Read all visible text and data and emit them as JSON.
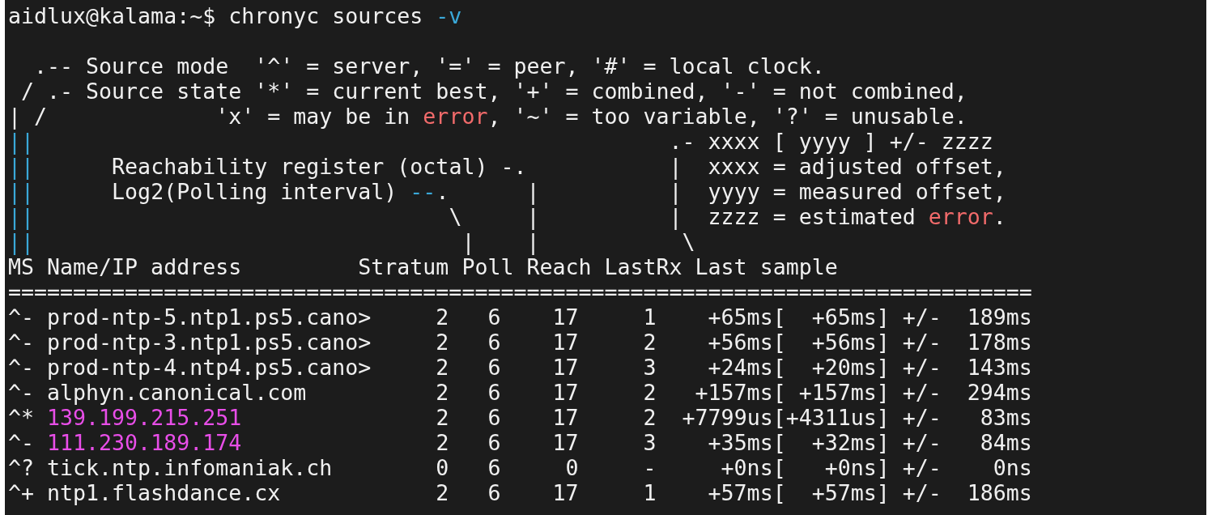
{
  "terminal": {
    "lines": [
      {
        "kind": "prompt",
        "segments": [
          {
            "kind": "plain",
            "text": "aidlux@kalama:~$ chronyc sources "
          },
          {
            "kind": "option",
            "text": "-v"
          }
        ]
      },
      {
        "kind": "blank"
      },
      {
        "kind": "output",
        "segments": [
          {
            "kind": "plain",
            "text": "  .-- Source mode  '^' = server, '=' = peer, '#' = local clock."
          }
        ]
      },
      {
        "kind": "output",
        "segments": [
          {
            "kind": "plain",
            "text": " / .- Source state '*' = current best, '+' = combined, '-' = not combined,"
          }
        ]
      },
      {
        "kind": "output",
        "segments": [
          {
            "kind": "plain",
            "text": "| /             'x' = may be in "
          },
          {
            "kind": "error",
            "text": "error"
          },
          {
            "kind": "plain",
            "text": ", '~' = too variable, '?' = unusable."
          }
        ]
      },
      {
        "kind": "output",
        "segments": [
          {
            "kind": "tree",
            "text": "||"
          },
          {
            "kind": "plain",
            "text": "                                                 .- xxxx [ yyyy ] +/- zzzz"
          }
        ]
      },
      {
        "kind": "output",
        "segments": [
          {
            "kind": "tree",
            "text": "||"
          },
          {
            "kind": "plain",
            "text": "      Reachability register (octal) -.           |  xxxx = adjusted offset,"
          }
        ]
      },
      {
        "kind": "output",
        "segments": [
          {
            "kind": "tree",
            "text": "||"
          },
          {
            "kind": "plain",
            "text": "      Log2(Polling interval) "
          },
          {
            "kind": "option",
            "text": "--"
          },
          {
            "kind": "plain",
            "text": ".      |          |  yyyy = measured offset,"
          }
        ]
      },
      {
        "kind": "output",
        "segments": [
          {
            "kind": "tree",
            "text": "||"
          },
          {
            "kind": "plain",
            "text": "                                \\     |          |  zzzz = estimated "
          },
          {
            "kind": "error",
            "text": "error"
          },
          {
            "kind": "plain",
            "text": "."
          }
        ]
      },
      {
        "kind": "output",
        "segments": [
          {
            "kind": "tree",
            "text": "||"
          },
          {
            "kind": "plain",
            "text": "                                 |    |           \\"
          }
        ]
      },
      {
        "kind": "header",
        "segments": [
          {
            "kind": "plain",
            "text": "MS Name/IP address         Stratum Poll Reach LastRx Last sample"
          }
        ]
      },
      {
        "kind": "rule",
        "segments": [
          {
            "kind": "plain",
            "text": "==============================================================================="
          }
        ]
      },
      {
        "kind": "row",
        "segments": [
          {
            "kind": "plain",
            "text": "^- prod-ntp-5.ntp1.ps5.cano>     2   6    17     1    +65ms[  +65ms] +/-  189ms"
          }
        ]
      },
      {
        "kind": "row",
        "segments": [
          {
            "kind": "plain",
            "text": "^- prod-ntp-3.ntp1.ps5.cano>     2   6    17     2    +56ms[  +56ms] +/-  178ms"
          }
        ]
      },
      {
        "kind": "row",
        "segments": [
          {
            "kind": "plain",
            "text": "^- prod-ntp-4.ntp4.ps5.cano>     2   6    17     3    +24ms[  +20ms] +/-  143ms"
          }
        ]
      },
      {
        "kind": "row",
        "segments": [
          {
            "kind": "plain",
            "text": "^- alphyn.canonical.com          2   6    17     2   +157ms[ +157ms] +/-  294ms"
          }
        ]
      },
      {
        "kind": "row",
        "segments": [
          {
            "kind": "plain",
            "text": "^* "
          },
          {
            "kind": "ip",
            "text": "139.199.215.251"
          },
          {
            "kind": "plain",
            "text": "               2   6    17     2  +7799us[+4311us] +/-   83ms"
          }
        ]
      },
      {
        "kind": "row",
        "segments": [
          {
            "kind": "plain",
            "text": "^- "
          },
          {
            "kind": "ip",
            "text": "111.230.189.174"
          },
          {
            "kind": "plain",
            "text": "               2   6    17     3    +35ms[  +32ms] +/-   84ms"
          }
        ]
      },
      {
        "kind": "row",
        "segments": [
          {
            "kind": "plain",
            "text": "^? tick.ntp.infomaniak.ch        0   6     0     -     +0ns[   +0ns] +/-    0ns"
          }
        ]
      },
      {
        "kind": "row",
        "segments": [
          {
            "kind": "plain",
            "text": "^+ ntp1.flashdance.cx            2   6    17     1    +57ms[  +57ms] +/-  186ms"
          }
        ]
      }
    ]
  }
}
